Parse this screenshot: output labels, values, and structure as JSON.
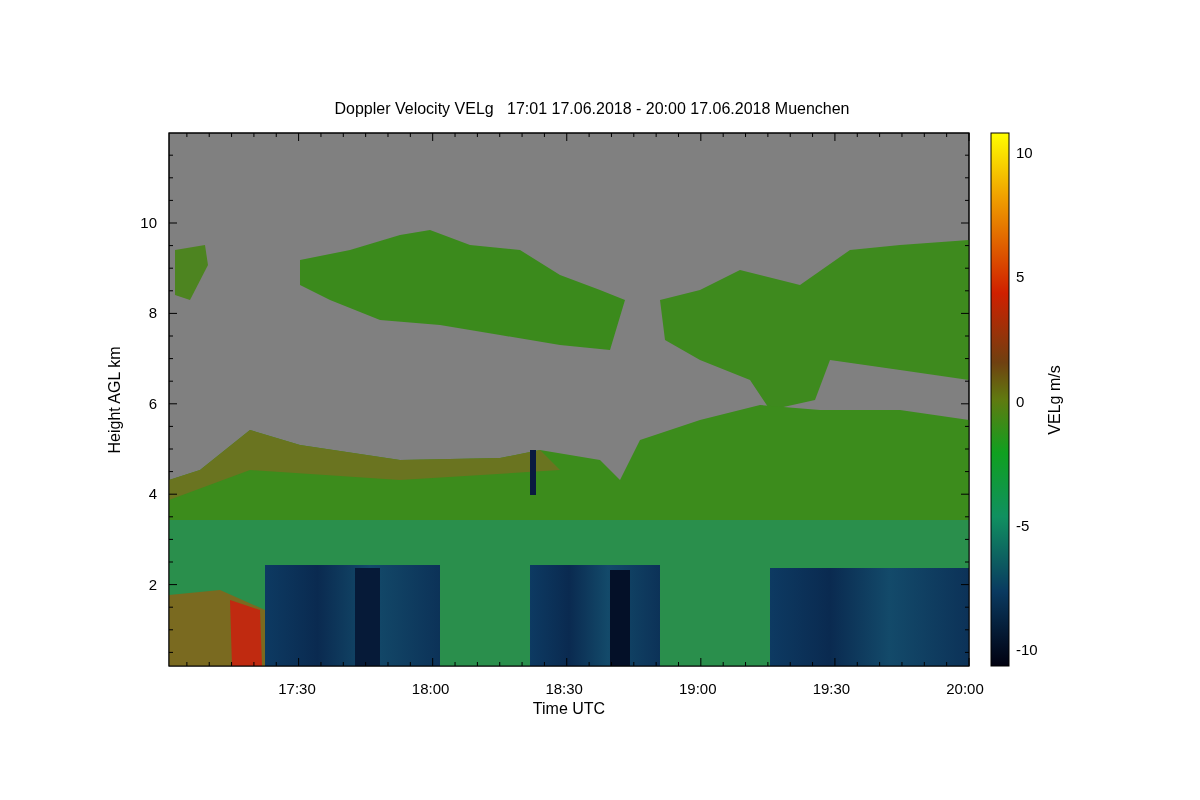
{
  "title": "Doppler Velocity VELg   17:01 17.06.2018 - 20:00 17.06.2018 Muenchen",
  "x_axis": {
    "label": "Time UTC",
    "ticks": [
      "17:30",
      "18:00",
      "18:30",
      "19:00",
      "19:30",
      "20:00"
    ]
  },
  "y_axis": {
    "label": "Height AGL km",
    "ticks": [
      "10",
      "8",
      "6",
      "4",
      "2"
    ]
  },
  "colorbar": {
    "label": "VELg m/s",
    "ticks": [
      "10",
      "5",
      "0",
      "-5",
      "-10"
    ]
  }
}
